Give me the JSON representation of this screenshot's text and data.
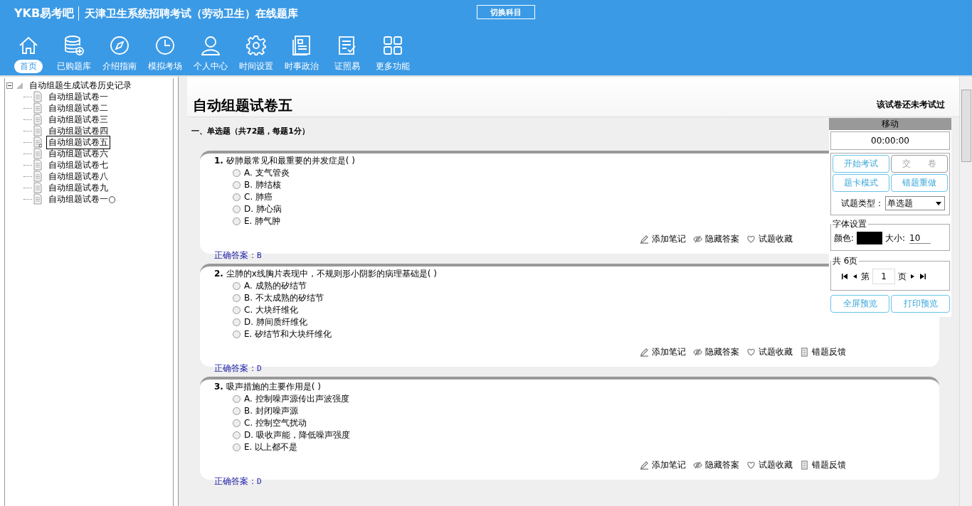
{
  "header": {
    "logo": "YKB易考吧",
    "title": "天津卫生系统招聘考试（劳动卫生）在线题库",
    "switch_button": "切换科目"
  },
  "nav": [
    {
      "label": "首页",
      "kind": "home",
      "selected": true
    },
    {
      "label": "已购题库",
      "kind": "database",
      "selected": false
    },
    {
      "label": "介绍指南",
      "kind": "compass",
      "selected": false
    },
    {
      "label": "模拟考场",
      "kind": "clock",
      "selected": false
    },
    {
      "label": "个人中心",
      "kind": "user",
      "selected": false
    },
    {
      "label": "时间设置",
      "kind": "gear",
      "selected": false
    },
    {
      "label": "时事政治",
      "kind": "news",
      "selected": false
    },
    {
      "label": "证照易",
      "kind": "list",
      "selected": false
    },
    {
      "label": "更多功能",
      "kind": "grid",
      "selected": false
    }
  ],
  "tree": {
    "label": "自动组题生成试卷历史记录",
    "expanded": true,
    "children": [
      {
        "label": "自动组题试卷一",
        "selected": false
      },
      {
        "label": "自动组题试卷二",
        "selected": false
      },
      {
        "label": "自动组题试卷三",
        "selected": false
      },
      {
        "label": "自动组题试卷四",
        "selected": false
      },
      {
        "label": "自动组题试卷五",
        "selected": true
      },
      {
        "label": "自动组题试卷六",
        "selected": false
      },
      {
        "label": "自动组题试卷七",
        "selected": false
      },
      {
        "label": "自动组题试卷八",
        "selected": false
      },
      {
        "label": "自动组题试卷九",
        "selected": false
      },
      {
        "label": "自动组题试卷一○",
        "selected": false
      }
    ]
  },
  "paper": {
    "title": "自动组题试卷五",
    "status": "该试卷还未考试过",
    "section": "一、单选题（共72题，每题1分）"
  },
  "questions": [
    {
      "number": "1.",
      "text": "矽肺最常见和最重要的并发症是( )",
      "options": [
        {
          "text": "A. 支气管炎",
          "selected": false
        },
        {
          "text": "B. 肺结核",
          "selected": false
        },
        {
          "text": "C. 肺癌",
          "selected": false
        },
        {
          "text": "D. 肺心病",
          "selected": false
        },
        {
          "text": "E. 肺气肿",
          "selected": false
        }
      ],
      "actions": [
        {
          "label": "添加笔记",
          "kind": "pencil"
        },
        {
          "label": "隐藏答案",
          "kind": "eye"
        },
        {
          "label": "试题收藏",
          "kind": "heart"
        }
      ],
      "answer_label": "正确答案：",
      "answer": "B"
    },
    {
      "number": "2.",
      "text": "尘肺的x线胸片表现中，不规则形小阴影的病理基础是( )",
      "options": [
        {
          "text": "A. 成熟的矽结节",
          "selected": false
        },
        {
          "text": "B. 不太成熟的矽结节",
          "selected": false
        },
        {
          "text": "C. 大块纤维化",
          "selected": false
        },
        {
          "text": "D. 肺间质纤维化",
          "selected": false
        },
        {
          "text": "E. 矽结节和大块纤维化",
          "selected": false
        }
      ],
      "actions": [
        {
          "label": "添加笔记",
          "kind": "pencil"
        },
        {
          "label": "隐藏答案",
          "kind": "eye"
        },
        {
          "label": "试题收藏",
          "kind": "heart"
        },
        {
          "label": "错题反馈",
          "kind": "feedback"
        }
      ],
      "answer_label": "正确答案：",
      "answer": "D"
    },
    {
      "number": "3.",
      "text": "吸声措施的主要作用是( )",
      "options": [
        {
          "text": "A. 控制噪声源传出声波强度",
          "selected": false
        },
        {
          "text": "B. 封闭噪声源",
          "selected": false
        },
        {
          "text": "C. 控制空气扰动",
          "selected": false
        },
        {
          "text": "D. 吸收声能，降低噪声强度",
          "selected": false
        },
        {
          "text": "E. 以上都不是",
          "selected": false
        }
      ],
      "actions": [
        {
          "label": "添加笔记",
          "kind": "pencil"
        },
        {
          "label": "隐藏答案",
          "kind": "eye"
        },
        {
          "label": "试题收藏",
          "kind": "heart"
        },
        {
          "label": "错题反馈",
          "kind": "feedback"
        }
      ],
      "answer_label": "正确答案：",
      "answer": "D"
    }
  ],
  "panel": {
    "move": "移动",
    "timer": "00:00:00",
    "buttons": [
      {
        "label": "开始考试",
        "disabled": false
      },
      {
        "label": "交　　卷",
        "disabled": true
      },
      {
        "label": "题卡模式",
        "disabled": false
      },
      {
        "label": "错题重做",
        "disabled": false
      }
    ],
    "type_label": "试题类型：",
    "type_value": "单选题",
    "font_group": "字体设置",
    "color_label": "颜色:",
    "size_label": "大小:",
    "size_value": "10",
    "pages_group": "共 6页",
    "page_prefix": "第",
    "page_value": "1",
    "page_suffix": "页",
    "bottom_buttons": [
      "全屏预览",
      "打印预览"
    ]
  }
}
